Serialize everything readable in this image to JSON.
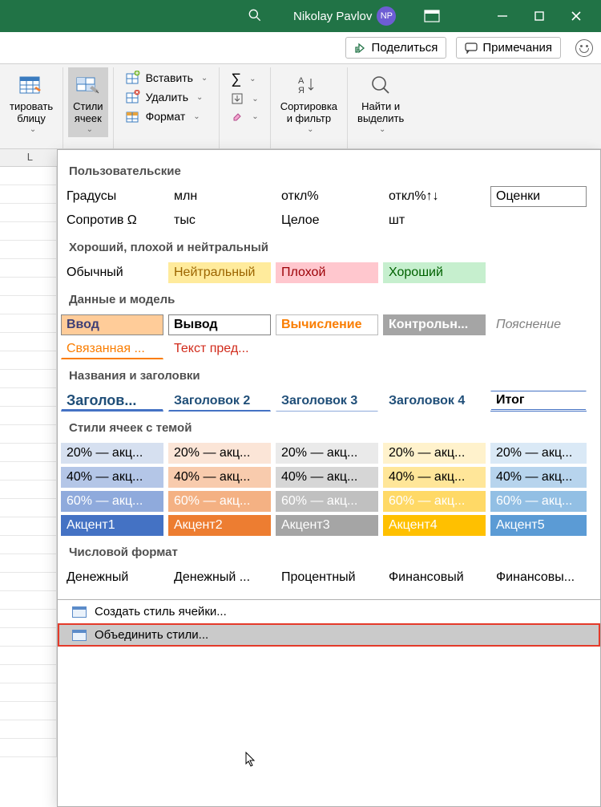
{
  "titlebar": {
    "username": "Nikolay Pavlov",
    "avatar_initials": "NP"
  },
  "cmdbar": {
    "share": "Поделиться",
    "comments": "Примечания"
  },
  "ribbon": {
    "format_table": "тировать\nблицу",
    "cell_styles": "Стили\nячеек",
    "insert": "Вставить",
    "delete": "Удалить",
    "format": "Формат",
    "sort_filter": "Сортировка\nи фильтр",
    "find_select": "Найти и\nвыделить"
  },
  "panel": {
    "sections": {
      "custom": "Пользовательские",
      "gbgn": "Хороший, плохой и нейтральный",
      "data_model": "Данные и модель",
      "titles": "Названия и заголовки",
      "themed": "Стили ячеек с темой",
      "number": "Числовой формат"
    },
    "custom_row1": [
      "Градусы",
      "млн",
      "откл%",
      "откл%↑↓",
      "Оценки"
    ],
    "custom_row2": [
      "Сопротив Ω",
      "тыс",
      "Целое",
      "шт",
      ""
    ],
    "gbgn_row": [
      "Обычный",
      "Нейтральный",
      "Плохой",
      "Хороший"
    ],
    "dm_row1": [
      "Ввод",
      "Вывод",
      "Вычисление",
      "Контрольн...",
      "Пояснение"
    ],
    "dm_row2": [
      "Связанная ...",
      "Текст пред..."
    ],
    "titles_row": [
      "Заголов...",
      "Заголовок 2",
      "Заголовок 3",
      "Заголовок 4",
      "Итог"
    ],
    "themed_rows": [
      [
        "20% — акц...",
        "20% — акц...",
        "20% — акц...",
        "20% — акц...",
        "20% — акц..."
      ],
      [
        "40% — акц...",
        "40% — акц...",
        "40% — акц...",
        "40% — акц...",
        "40% — акц..."
      ],
      [
        "60% — акц...",
        "60% — акц...",
        "60% — акц...",
        "60% — акц...",
        "60% — акц..."
      ],
      [
        "Акцент1",
        "Акцент2",
        "Акцент3",
        "Акцент4",
        "Акцент5"
      ]
    ],
    "number_row": [
      "Денежный",
      "Денежный ...",
      "Процентный",
      "Финансовый",
      "Финансовы..."
    ],
    "menu": {
      "new_style": "Создать стиль ячейки...",
      "merge_styles": "Объединить стили..."
    }
  },
  "colors": {
    "accent1": "#4472c4",
    "accent2": "#ed7d31",
    "accent3": "#a5a5a5",
    "accent4": "#ffc000",
    "accent5": "#5b9bd5",
    "a1_20": "#d6e0f0",
    "a2_20": "#fbe5d7",
    "a3_20": "#eaeaea",
    "a4_20": "#fff2cc",
    "a5_20": "#dae9f6",
    "a1_40": "#b4c6e7",
    "a2_40": "#f8cbad",
    "a3_40": "#d6d6d6",
    "a4_40": "#ffe699",
    "a5_40": "#b7d4ed",
    "a1_60": "#8faadc",
    "a2_60": "#f4b183",
    "a3_60": "#c0c0c0",
    "a4_60": "#ffd966",
    "a5_60": "#92bfe4",
    "neutral": "#ffeb9c",
    "bad": "#ffc7ce",
    "good": "#c6efce",
    "neutral_t": "#9c6500",
    "bad_t": "#9c0006",
    "good_t": "#006100",
    "input_bg": "#ffcc99",
    "output_border": "#808080",
    "calc_t": "#fa7d00",
    "check_bg": "#a5a5a5",
    "note_t": "#808080",
    "linked_t": "#fa7d00"
  }
}
